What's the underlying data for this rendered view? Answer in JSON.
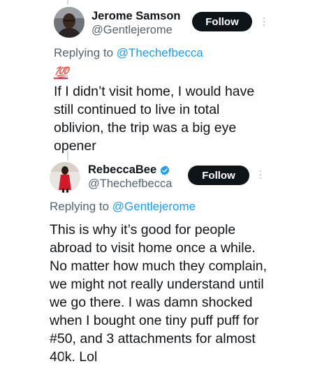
{
  "posts": [
    {
      "display_name": "Jerome Samson",
      "handle": "@Gentlejerome",
      "follow_label": "Follow",
      "replying_prefix": "Replying to ",
      "replying_to": "@Thechefbecca",
      "emoji": "💯",
      "emoji_name": "hundred-points-icon",
      "text": "If I didn’t visit home, I would have\nstill continued to live in total\noblivion, the trip was a big eye\nopener"
    },
    {
      "display_name": "RebeccaBee",
      "handle": "@Thechefbecca",
      "verified": true,
      "follow_label": "Follow",
      "replying_prefix": "Replying to ",
      "replying_to": "@Gentlejerome",
      "text": "This is why it’s good for people\nabroad to visit home once a while.\nNo matter how much they complain,\nwe might not really understand until\nwe go there. I was damn shocked\nwhen I bought one tiny puff puff for\n#50, and 3 attachments for almost\n40k. Lol"
    }
  ],
  "colors": {
    "mention": "#1d9bf0",
    "secondary_text": "#536471",
    "follow_bg": "#0f1419",
    "verified": "#1d9bf0"
  }
}
